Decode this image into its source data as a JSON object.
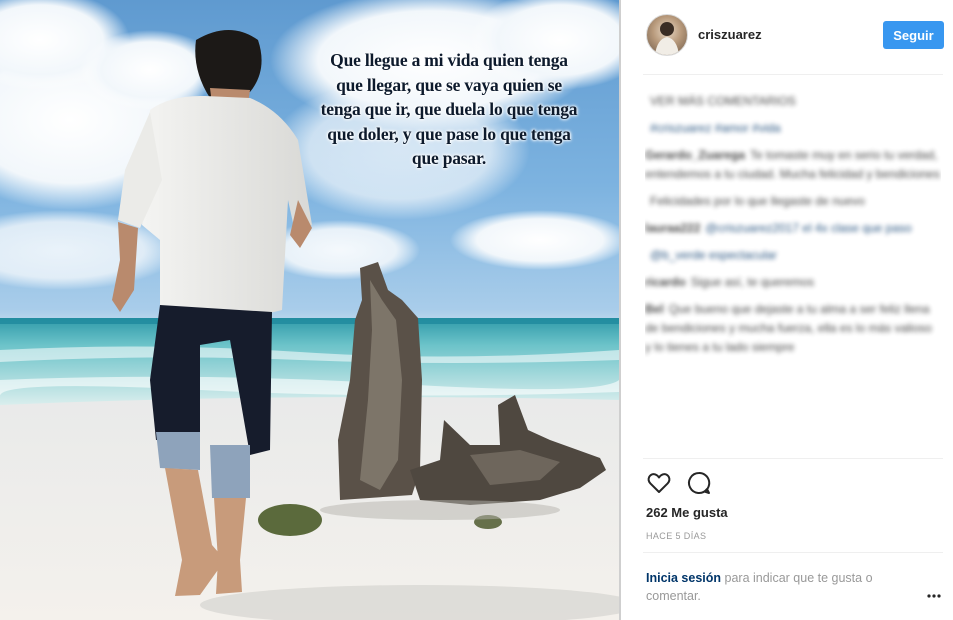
{
  "post": {
    "quote": "Que llegue a mi vida quien tenga que llegar, que se vaya quien se tenga que ir, que duela lo que tenga que doler, y que pase lo que tenga que pasar."
  },
  "header": {
    "username": "criszuarez",
    "follow_label": "Seguir"
  },
  "comments": [
    {
      "user": "",
      "text": "VER MÁS COMENTARIOS"
    },
    {
      "user": "",
      "text": "#criszuarez #amor #vida"
    },
    {
      "user": "Gerardo_Zuarega",
      "text": "Te tomaste muy en serio tu verdad, entendemos a tu ciudad. Mucha felicidad y bendiciones"
    },
    {
      "user": "",
      "text": "Felicidades por lo que llegaste de nuevo"
    },
    {
      "user": "lauraa222",
      "text": "@criszuarez2017 el 4x clase que paso"
    },
    {
      "user": "",
      "text": "@b_verde espectacular"
    },
    {
      "user": "ricardo",
      "text": "Sigue así, te queremos"
    },
    {
      "user": "Bel",
      "text": "Que bueno que dejaste a tu alma a ser feliz llena de bendiciones y mucha fuerza, ella es lo más valioso y lo tienes a tu lado siempre"
    }
  ],
  "actions": {
    "like_icon": "heart-icon",
    "comment_icon": "comment-bubble-icon"
  },
  "likes_label": "262 Me gusta",
  "time_label": "HACE 5 DÍAS",
  "login_prompt": {
    "link": "Inicia sesión",
    "text": " para indicar que te gusta o comentar."
  },
  "more_icon": "ellipsis-icon",
  "colors": {
    "accent": "#3897f0",
    "link": "#003569",
    "text": "#262626",
    "muted": "#999999"
  }
}
